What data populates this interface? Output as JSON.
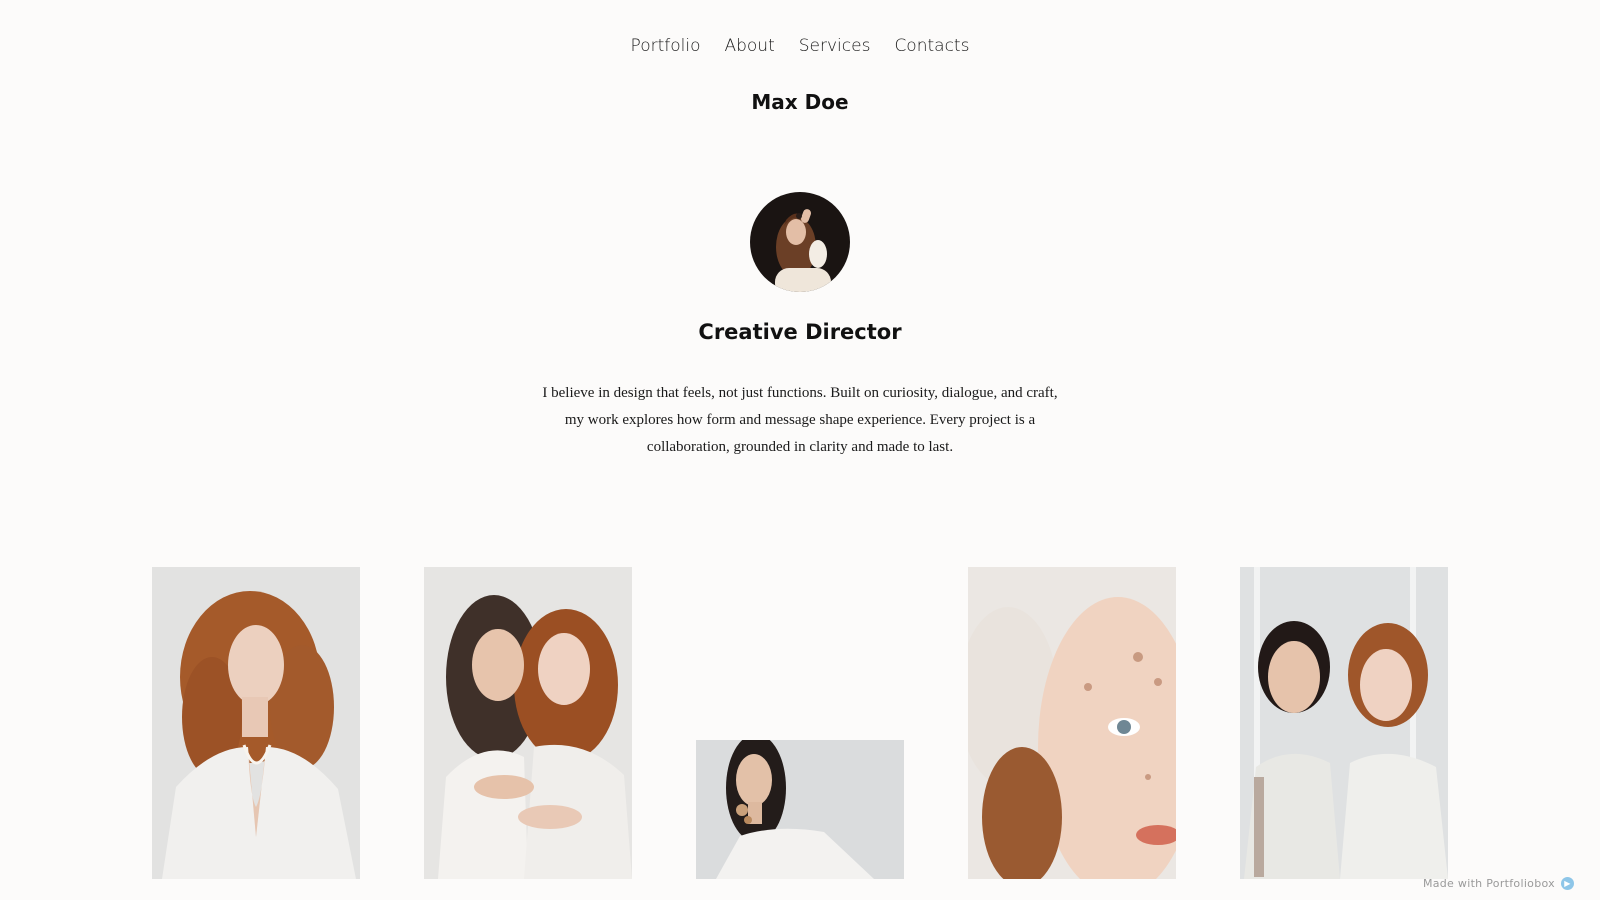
{
  "nav": {
    "items": [
      "Portfolio",
      "About",
      "Services",
      "Contacts"
    ]
  },
  "site": {
    "title": "Max Doe"
  },
  "profile": {
    "role": "Creative Director",
    "bio": "I believe in design that feels, not just functions. Built on curiosity, dialogue, and craft, my work explores how form and message shape experience. Every project is a collaboration, grounded in clarity and made to last."
  },
  "gallery": {
    "photos": [
      {
        "name": "red-haired-model-white-blazer-photo"
      },
      {
        "name": "two-models-embracing-photo"
      },
      {
        "name": "model-with-flowers-photo"
      },
      {
        "name": "face-with-shadow-closeup-photo"
      },
      {
        "name": "two-models-standing-photo"
      }
    ]
  },
  "footer": {
    "badge_text": "Made with Portfoliobox",
    "badge_icon": "portfoliobox-logo-icon"
  },
  "colors": {
    "background": "#fcfbfa",
    "text": "#111111",
    "badge_logo": "#8ec6e8"
  }
}
